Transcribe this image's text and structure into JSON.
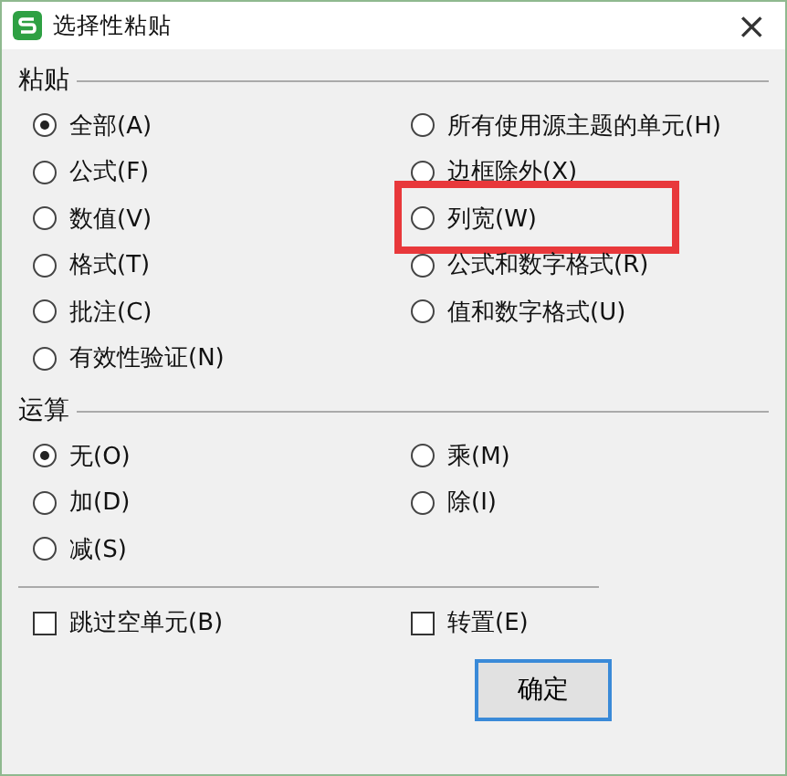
{
  "window": {
    "title": "选择性粘贴",
    "close": "×"
  },
  "paste": {
    "title": "粘贴",
    "options": [
      {
        "label": "全部(A)",
        "selected": true,
        "highlighted": false
      },
      {
        "label": "所有使用源主题的单元(H)",
        "selected": false,
        "highlighted": false
      },
      {
        "label": "公式(F)",
        "selected": false,
        "highlighted": false
      },
      {
        "label": "边框除外(X)",
        "selected": false,
        "highlighted": false
      },
      {
        "label": "数值(V)",
        "selected": false,
        "highlighted": false
      },
      {
        "label": "列宽(W)",
        "selected": false,
        "highlighted": true
      },
      {
        "label": "格式(T)",
        "selected": false,
        "highlighted": false
      },
      {
        "label": "公式和数字格式(R)",
        "selected": false,
        "highlighted": false
      },
      {
        "label": "批注(C)",
        "selected": false,
        "highlighted": false
      },
      {
        "label": "值和数字格式(U)",
        "selected": false,
        "highlighted": false
      },
      {
        "label": "有效性验证(N)",
        "selected": false,
        "highlighted": false
      }
    ]
  },
  "operation": {
    "title": "运算",
    "options": [
      {
        "label": "无(O)",
        "selected": true
      },
      {
        "label": "乘(M)",
        "selected": false
      },
      {
        "label": "加(D)",
        "selected": false
      },
      {
        "label": "除(I)",
        "selected": false
      },
      {
        "label": "减(S)",
        "selected": false
      }
    ]
  },
  "checkboxes": [
    {
      "label": "跳过空单元(B)",
      "checked": false
    },
    {
      "label": "转置(E)",
      "checked": false
    }
  ],
  "buttons": [
    {
      "label": "确定"
    }
  ]
}
